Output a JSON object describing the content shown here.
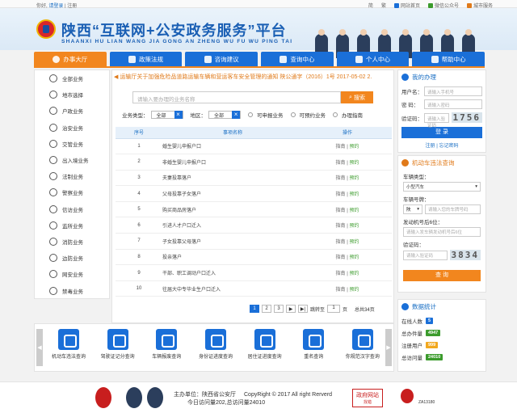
{
  "topbar": {
    "prefix": "你好,",
    "login": "请登录",
    "sep": "|",
    "register": "注册",
    "right": [
      "简",
      "繁",
      "网站首页",
      "微信公众号",
      "城市服务"
    ]
  },
  "header": {
    "title": "陕西“互联网+公安政务服务”平台",
    "subtitle": "SHAANXI HU LIAN WANG JIA GONG AN ZHENG WU FU WU PING TAI"
  },
  "nav": [
    "办事大厅",
    "政策法规",
    "咨询建议",
    "查询中心",
    "个人中心",
    "帮助中心"
  ],
  "sidebar": [
    "全部业务",
    "地市选择",
    "户政业务",
    "治安业务",
    "交管业务",
    "出入境业务",
    "法制业务",
    "警察业务",
    "信访业务",
    "监所业务",
    "消防业务",
    "边防业务",
    "网安业务",
    "禁毒业务"
  ],
  "notice": "运输厅关于加强危险品道路运输车辆和营运客车安全管理的通知 陕公通字（2016）1号 2017-05-02   2.",
  "search": {
    "placeholder": "请输入要办理的业务名称",
    "button": "搜索"
  },
  "filters": {
    "type_label": "业务类型：",
    "type_value": "全部",
    "area_label": "地区：",
    "area_value": "全部",
    "opts": [
      "可申报业务",
      "可预约业务",
      "办理指南"
    ]
  },
  "table": {
    "headers": [
      "序号",
      "事项名称",
      "操作"
    ],
    "op_guide": "指南",
    "op_book": "预约",
    "op_sep": "|",
    "rows": [
      {
        "no": "1",
        "name": "婚生婴儿申报户口"
      },
      {
        "no": "2",
        "name": "非婚生婴儿申报户口"
      },
      {
        "no": "3",
        "name": "夫妻投靠落户"
      },
      {
        "no": "4",
        "name": "父母投靠子女落户"
      },
      {
        "no": "5",
        "name": "购买商品房落户"
      },
      {
        "no": "6",
        "name": "引进人才户口迁入"
      },
      {
        "no": "7",
        "name": "子女投靠父母落户"
      },
      {
        "no": "8",
        "name": "投亲落户"
      },
      {
        "no": "9",
        "name": "干部、职工调动户口迁入"
      },
      {
        "no": "10",
        "name": "往届大中专毕业生户口迁入"
      }
    ]
  },
  "pager": {
    "pages": [
      "1",
      "2",
      "3"
    ],
    "goto": "跳转至",
    "input": "1",
    "unit": "页",
    "total": "总共34页"
  },
  "login": {
    "title": "我的办理",
    "user_label": "用户名：",
    "user_ph": "请输入手机号",
    "pwd_label": "密  码：",
    "pwd_ph": "请输入密码",
    "code_label": "验证码：",
    "code_ph": "请输入验证码",
    "captcha": "1756",
    "button": "登 录",
    "register": "注册",
    "forgot": "忘记密码",
    "link_sep": "|"
  },
  "violation": {
    "title": "机动车违法查询",
    "type_label": "车辆类型：",
    "type_value": "小型汽车",
    "plate_label": "车辆号牌：",
    "plate_prefix": "陕",
    "plate_ph": "请输入您的车牌号码",
    "engine_label": "发动机号后6位：",
    "engine_ph": "请输入发车辆发动机号后6位",
    "code_label": "验证码：",
    "code_ph": "请输入验证码",
    "captcha": "3834",
    "button": "查 询"
  },
  "stats": {
    "title": "数据统计",
    "online_label": "在线人数",
    "online": "5",
    "total_label": "总办件量",
    "total": "4947",
    "user_label": "注册用户",
    "user": "999",
    "visit_label": "总访问量",
    "visit": "24010"
  },
  "services": [
    "机动车违法查询",
    "驾驶证记分查询",
    "车辆报废查询",
    "身份证进度查询",
    "居住证进度查询",
    "重名查询",
    "你规范汉字查询"
  ],
  "footer": {
    "host": "主办单位：陕西省公安厅",
    "copy": "CopyRight © 2017 All right Rerverd",
    "today": "今日访问量202,总访问量24010",
    "gov": "政府网站",
    "gov2": "找错",
    "id": "ZA13180"
  }
}
